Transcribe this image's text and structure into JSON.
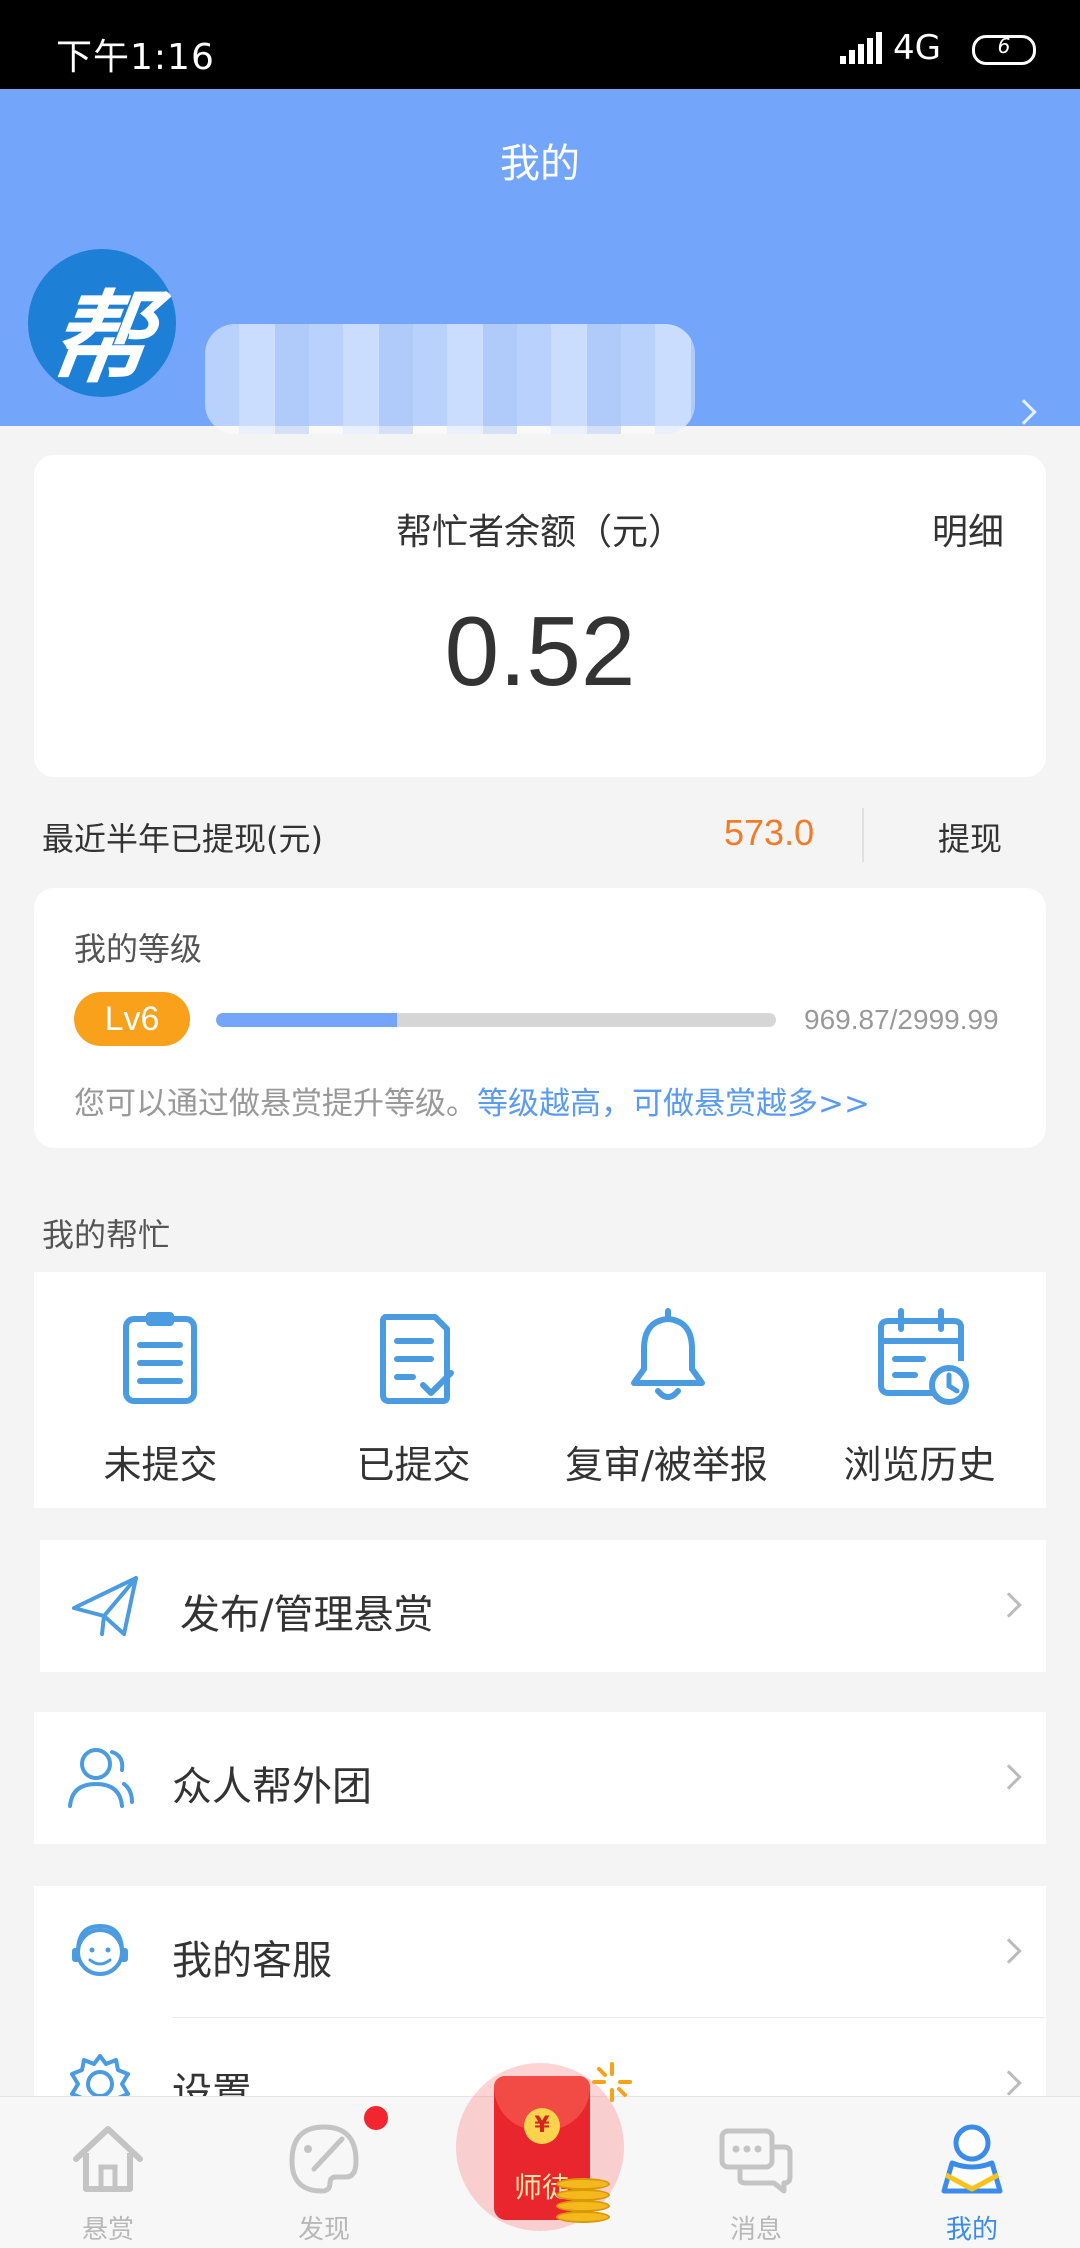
{
  "status_bar": {
    "time": "下午1:16",
    "network": "4G",
    "battery": "6"
  },
  "header": {
    "title": "我的",
    "avatar_glyph": "帮"
  },
  "balance": {
    "label": "帮忙者余额（元）",
    "detail_link": "明细",
    "value": "0.52"
  },
  "withdraw": {
    "label": "最近半年已提现(元)",
    "amount": "573.0",
    "button": "提现"
  },
  "level": {
    "title": "我的等级",
    "badge": "Lv6",
    "progress_text": "969.87/2999.99",
    "progress_fraction": 0.3233,
    "tip": "您可以通过做悬赏提升等级。",
    "tip_link": "等级越高，可做悬赏越多>>"
  },
  "my_help": {
    "title": "我的帮忙",
    "items": [
      {
        "label": "未提交",
        "icon": "clipboard-icon"
      },
      {
        "label": "已提交",
        "icon": "document-check-icon"
      },
      {
        "label": "复审/被举报",
        "icon": "bell-icon"
      },
      {
        "label": "浏览历史",
        "icon": "calendar-clock-icon"
      }
    ]
  },
  "menu": [
    {
      "label": "发布/管理悬赏",
      "icon": "paper-plane-icon"
    },
    {
      "label": "众人帮外团",
      "icon": "users-icon"
    },
    {
      "label": "我的客服",
      "icon": "customer-service-icon"
    },
    {
      "label": "设置",
      "icon": "settings-gear-icon"
    }
  ],
  "tab_bar": {
    "tabs": [
      {
        "label": "悬赏",
        "icon": "home-icon"
      },
      {
        "label": "发现",
        "icon": "palette-icon"
      },
      {
        "label": "",
        "icon": "red-packet-icon"
      },
      {
        "label": "消息",
        "icon": "chat-icon"
      },
      {
        "label": "我的",
        "icon": "profile-icon"
      }
    ],
    "center_label": "师徒",
    "center_coin_symbol": "¥",
    "active_index": 4
  },
  "colors": {
    "header": "#73a6fb",
    "accent_orange": "#f07c2a",
    "level_badge": "#f9a11b",
    "link_blue": "#5b9bef",
    "icon_blue": "#4a9be0",
    "tab_active": "#3b8beb"
  }
}
